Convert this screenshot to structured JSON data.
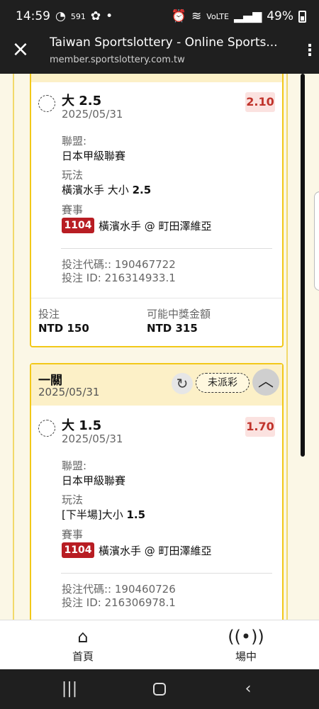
{
  "status_bar": {
    "time": "14:59",
    "notif_label": "591",
    "network_label": "VoLTE",
    "battery_percent": "49%"
  },
  "browser": {
    "title": "Taiwan Sportslottery - Online Sports...",
    "url": "member.sportslottery.com.tw"
  },
  "bet1": {
    "selection": "大 2.5",
    "date": "2025/05/31",
    "odds": "2.10",
    "league_label": "聯盟:",
    "league_value": "日本甲級聯賽",
    "market_label": "玩法",
    "market_prefix": "橫濱水手 大小",
    "market_line": "2.5",
    "event_label": "賽事",
    "event_code": "1104",
    "event_value": "橫濱水手 @ 町田澤維亞",
    "bet_code": "投注代碼:: 190467722",
    "bet_id": "投注 ID: 216314933.1",
    "stake_label": "投注",
    "stake_value": "NTD 150",
    "payout_label": "可能中獎金額",
    "payout_value": "NTD 315"
  },
  "bet2": {
    "header_title": "一關",
    "header_date": "2025/05/31",
    "status_label": "未派彩",
    "selection": "大 1.5",
    "date": "2025/05/31",
    "odds": "1.70",
    "league_label": "聯盟:",
    "league_value": "日本甲級聯賽",
    "market_label": "玩法",
    "market_prefix": "[下半場]大小",
    "market_line": "1.5",
    "event_label": "賽事",
    "event_code": "1104",
    "event_value": "橫濱水手 @ 町田澤維亞",
    "bet_code": "投注代碼:: 190460726",
    "bet_id": "投注 ID: 216306978.1"
  },
  "bottom_nav": {
    "home_label": "首頁",
    "live_label": "場中"
  },
  "colors": {
    "accent_border": "#f2c819",
    "header_band": "#fcf0c7",
    "odds_text": "#c0332b",
    "event_badge": "#b81d23"
  }
}
